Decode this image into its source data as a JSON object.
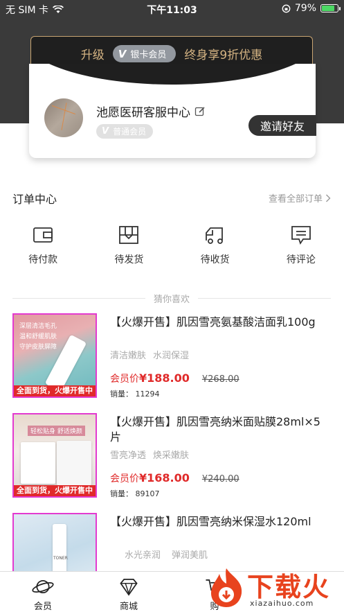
{
  "status_bar": {
    "carrier": "无 SIM 卡",
    "time": "下午11:03",
    "battery": "79%",
    "battery_level": 0.79
  },
  "vip_banner": {
    "upgrade": "升级",
    "badge": "银卡会员",
    "benefit": "终身享9折优惠"
  },
  "profile": {
    "name": "池愿医研客服中心",
    "level": "普通会员",
    "invite_button": "邀请好友"
  },
  "orders": {
    "title": "订单中心",
    "view_all": "查看全部订单",
    "items": [
      {
        "label": "待付款",
        "icon": "wallet-icon"
      },
      {
        "label": "待发货",
        "icon": "package-icon"
      },
      {
        "label": "待收货",
        "icon": "truck-icon"
      },
      {
        "label": "待评论",
        "icon": "comment-icon"
      }
    ]
  },
  "guess_label": "猜你喜欢",
  "products": [
    {
      "title": "【火爆开售】肌因雪亮氨基酸洁面乳100g",
      "tags": [
        "清洁嫩肤",
        "水润保湿"
      ],
      "member_label": "会员价",
      "price": "¥188.00",
      "original_price": "¥268.00",
      "sales": "销量： 11294",
      "image_banner": "全面到货，火爆开售中",
      "image_text": [
        "深层清洁毛孔",
        "温和舒缓肌肤",
        "守护皮肤屏障"
      ]
    },
    {
      "title": "【火爆开售】肌因雪亮纳米面贴膜28ml×5片",
      "tags": [
        "雪亮净透",
        "焕采嫩肤"
      ],
      "member_label": "会员价",
      "price": "¥168.00",
      "original_price": "¥240.00",
      "sales": "销量： 89107",
      "image_banner": "全面到货，火爆开售中",
      "image_text": [
        "轻松贴身 舒适焕颜"
      ]
    },
    {
      "title": "【火爆开售】肌因雪亮纳米保湿水120ml",
      "tags": [
        "水光亲润",
        "弹润美肌"
      ],
      "image_text": [
        "TONER"
      ]
    }
  ],
  "bottom_nav": [
    {
      "label": "会员",
      "icon": "planet-icon"
    },
    {
      "label": "商城",
      "icon": "diamond-icon"
    },
    {
      "label": "购",
      "icon": "cart-icon"
    }
  ],
  "watermark": {
    "text": "下载火",
    "url": "xiazaihuo.com"
  },
  "colors": {
    "accent_red": "#e02a2a",
    "gold": "#d5b483",
    "dark": "#1f1f1f"
  }
}
